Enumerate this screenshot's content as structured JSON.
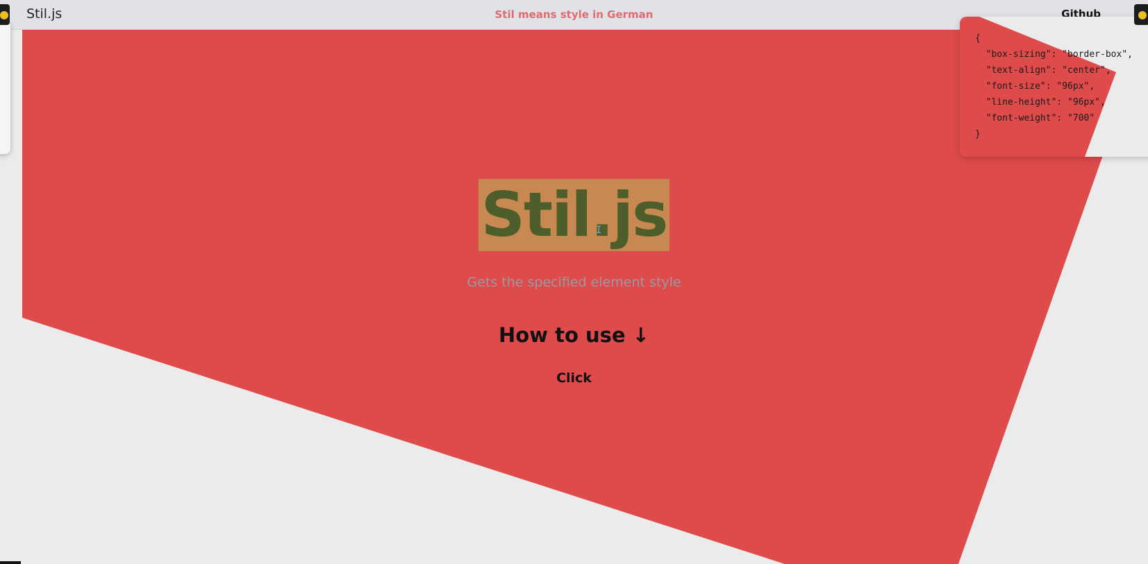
{
  "header": {
    "brand": "Stil.js",
    "tagline": "Stil means style in German",
    "github_label": "Github"
  },
  "hero": {
    "title": "Stil.js",
    "subtitle": "Gets the specified element style",
    "how_to_use": "How to use ↓",
    "click_label": "Click"
  },
  "style_panel": {
    "code": "{\n  \"box-sizing\": \"border-box\",\n  \"text-align\": \"center\",\n  \"font-size\": \"96px\",\n  \"line-height\": \"96px\",\n  \"font-weight\": \"700\"\n}"
  },
  "colors": {
    "red_shape": "#df4a4a",
    "header_bg": "#e1e2e5",
    "tagline": "#e06a6f",
    "page_bg": "#ebebeb",
    "highlight": "#c09e54",
    "hero_text": "#4d5e2b"
  },
  "icons": {
    "corner_left": "sun-icon",
    "corner_right": "sun-icon",
    "cursor": "text-cursor-icon"
  }
}
